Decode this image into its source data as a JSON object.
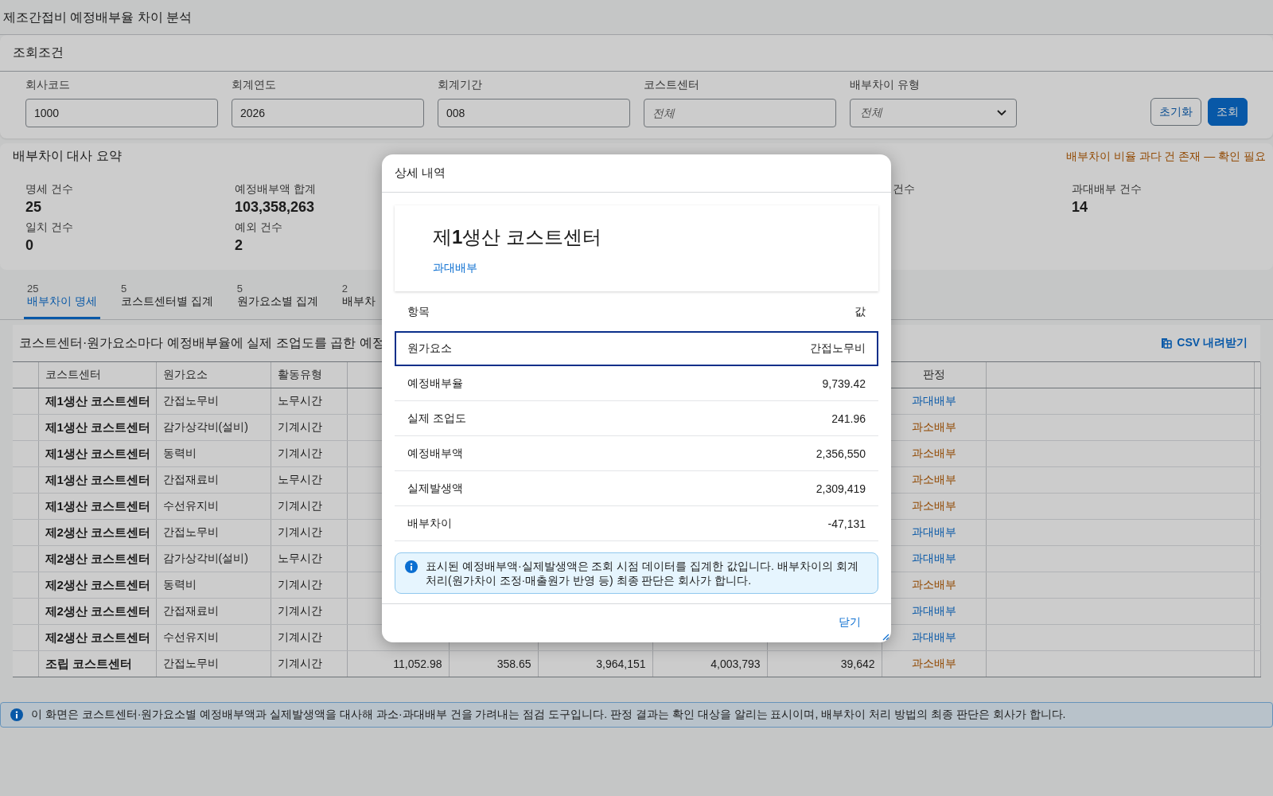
{
  "page_title": "제조간접비 예정배부율 차이 분석",
  "filter_panel": {
    "title": "조회조건",
    "fields": [
      {
        "label": "회사코드",
        "kind": "text",
        "value": "1000"
      },
      {
        "label": "회계연도",
        "kind": "text",
        "value": "2026"
      },
      {
        "label": "회계기간",
        "kind": "text",
        "value": "008"
      },
      {
        "label": "코스트센터",
        "kind": "text",
        "placeholder": "전체"
      },
      {
        "label": "배부차이 유형",
        "kind": "select",
        "placeholder": "전체"
      }
    ],
    "buttons": [
      {
        "label": "초기화",
        "kind": "secondary"
      },
      {
        "label": "조회",
        "kind": "primary"
      }
    ]
  },
  "summary": {
    "title": "배부차이 대사 요약",
    "warning": "배부차이 비율 과다 건 존재 — 확인 필요",
    "stats_row_1": [
      {
        "label": "명세 건수",
        "value": "25"
      },
      {
        "label": "예정배부액 합계",
        "value": "103,358,263"
      },
      {
        "label": "건수"
      },
      {
        "label": "과대배부 건수",
        "value": "14"
      }
    ],
    "stats_row_2": [
      {
        "label": "일치 건수",
        "value": "0"
      },
      {
        "label": "예외 건수",
        "value": "2"
      }
    ]
  },
  "tabs": [
    {
      "count": "25",
      "label": "배부차이 명세",
      "selected": true
    },
    {
      "count": "5",
      "label": "코스트센터별 집계",
      "selected": false
    },
    {
      "count": "5",
      "label": "원가요소별 집계",
      "selected": false
    },
    {
      "count": "2",
      "label": "배부차",
      "selected": false
    }
  ],
  "table": {
    "caption": "코스트센터·원가요소마다 예정배부율에 실제 조업도를 곱한 예정",
    "download_button": "CSV 내려받기",
    "columns": [
      {
        "label": "코스트센터"
      },
      {
        "label": "원가요소"
      },
      {
        "label": "활동유형"
      },
      {
        "label": "판정"
      }
    ],
    "rows": [
      {
        "cost_center": "제1생산 코스트센터",
        "cost_element": "간접노무비",
        "activity_type": "노무시간",
        "verdict": "과대배부",
        "color": "#0858a7"
      },
      {
        "cost_center": "제1생산 코스트센터",
        "cost_element": "감가상각비(설비)",
        "activity_type": "기계시간",
        "verdict": "과소배부",
        "color": "#914800"
      },
      {
        "cost_center": "제1생산 코스트센터",
        "cost_element": "동력비",
        "activity_type": "기계시간",
        "verdict": "과소배부",
        "color": "#914800"
      },
      {
        "cost_center": "제1생산 코스트센터",
        "cost_element": "간접재료비",
        "activity_type": "노무시간",
        "verdict": "과소배부",
        "color": "#914800"
      },
      {
        "cost_center": "제1생산 코스트센터",
        "cost_element": "수선유지비",
        "activity_type": "기계시간",
        "verdict": "과소배부",
        "color": "#914800"
      },
      {
        "cost_center": "제2생산 코스트센터",
        "cost_element": "간접노무비",
        "activity_type": "기계시간",
        "verdict": "과대배부",
        "color": "#0858a7"
      },
      {
        "cost_center": "제2생산 코스트센터",
        "cost_element": "감가상각비(설비)",
        "activity_type": "노무시간",
        "verdict": "과대배부",
        "color": "#0858a7"
      },
      {
        "cost_center": "제2생산 코스트센터",
        "cost_element": "동력비",
        "activity_type": "기계시간",
        "verdict": "과소배부",
        "color": "#914800"
      },
      {
        "cost_center": "제2생산 코스트센터",
        "cost_element": "간접재료비",
        "activity_type": "기계시간",
        "verdict": "과대배부",
        "color": "#0858a7"
      },
      {
        "cost_center": "제2생산 코스트센터",
        "cost_element": "수선유지비",
        "activity_type": "기계시간",
        "verdict": "과대배부",
        "color": "#0858a7"
      },
      {
        "cost_center": "조립 코스트센터",
        "cost_element": "간접노무비",
        "activity_type": "기계시간",
        "values": [
          "11,052.98",
          "358.65",
          "3,964,151",
          "4,003,793",
          "39,642"
        ],
        "verdict": "과소배부",
        "color": "#914800"
      }
    ]
  },
  "footer_notice": "이 화면은 코스트센터·원가요소별 예정배부액과 실제발생액을 대사해 과소·과대배부 건을 가려내는 점검 도구입니다. 판정 결과는 확인 대상을 알리는 표시이며, 배부차이 처리 방법의 최종 판단은 회사가 합니다.",
  "dialog": {
    "title": "상세 내역",
    "heading": "제**1**생산 코스트센터",
    "status": {
      "text": "과대배부",
      "color": "#0a6ed1"
    },
    "header": {
      "item": "항목",
      "value": "값"
    },
    "rows": [
      {
        "item": "원가요소",
        "value": "간접노무비",
        "selected": true
      },
      {
        "item": "예정배부율",
        "value": "9,739.42",
        "selected": false
      },
      {
        "item": "실제 조업도",
        "value": "241.96",
        "selected": false
      },
      {
        "item": "예정배부액",
        "value": "2,356,550",
        "selected": false
      },
      {
        "item": "실제발생액",
        "value": "2,309,419",
        "selected": false
      },
      {
        "item": "배부차이",
        "value": "-47,131",
        "selected": false
      }
    ],
    "info": "표시된 예정배부액·실제발생액은 조회 시점 데이터를 집계한 값입니다. 배부차이의 회계 처리(원가차이 조정·매출원가 반영 등) 최종 판단은 회사가 합니다.",
    "close_button": "닫기"
  }
}
